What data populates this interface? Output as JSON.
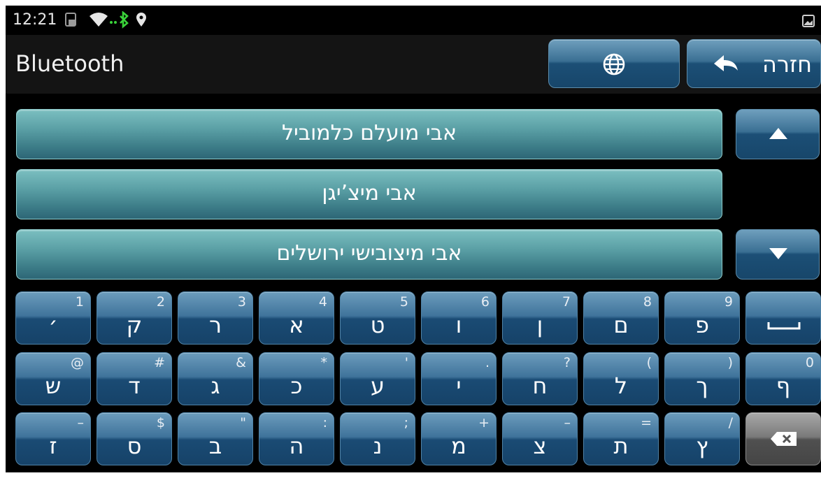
{
  "status_bar": {
    "time": "12:21",
    "icons": [
      "sim-icon",
      "wifi-icon",
      "bluetooth-icon",
      "location-icon",
      "screenshot-icon"
    ]
  },
  "header": {
    "title": "Bluetooth",
    "back_label": "חזרה",
    "language_icon": "globe-icon"
  },
  "list": {
    "items": [
      {
        "label": "אבי מועלם כלמוביל"
      },
      {
        "label": "אבי מיצ’יגן"
      },
      {
        "label": "אבי מיצובישי ירושלים"
      }
    ]
  },
  "keyboard": {
    "rows": [
      [
        {
          "main": "׳",
          "sub": "1"
        },
        {
          "main": "ק",
          "sub": "2"
        },
        {
          "main": "ר",
          "sub": "3"
        },
        {
          "main": "א",
          "sub": "4"
        },
        {
          "main": "ט",
          "sub": "5"
        },
        {
          "main": "ו",
          "sub": "6"
        },
        {
          "main": "ן",
          "sub": "7"
        },
        {
          "main": "ם",
          "sub": "8"
        },
        {
          "main": "פ",
          "sub": "9"
        },
        {
          "main": "␣",
          "sub": ""
        }
      ],
      [
        {
          "main": "ש",
          "sub": "@"
        },
        {
          "main": "ד",
          "sub": "#"
        },
        {
          "main": "ג",
          "sub": "&"
        },
        {
          "main": "כ",
          "sub": "*"
        },
        {
          "main": "ע",
          "sub": "'"
        },
        {
          "main": "י",
          "sub": "."
        },
        {
          "main": "ח",
          "sub": "?"
        },
        {
          "main": "ל",
          "sub": "("
        },
        {
          "main": "ך",
          "sub": ")"
        },
        {
          "main": "ף",
          "sub": "0"
        }
      ],
      [
        {
          "main": "ז",
          "sub": "–"
        },
        {
          "main": "ס",
          "sub": "$"
        },
        {
          "main": "ב",
          "sub": "\""
        },
        {
          "main": "ה",
          "sub": ":"
        },
        {
          "main": "נ",
          "sub": ";"
        },
        {
          "main": "מ",
          "sub": "+"
        },
        {
          "main": "צ",
          "sub": "–"
        },
        {
          "main": "ת",
          "sub": "="
        },
        {
          "main": "ץ",
          "sub": "/"
        },
        {
          "main": "",
          "sub": "",
          "icon": "backspace-icon"
        }
      ]
    ]
  },
  "colors": {
    "key_blue": "#2a5f88",
    "row_teal": "#5a9fa5",
    "backspace_gray": "#6b6b6b",
    "bluetooth_green": "#3ad33a"
  }
}
